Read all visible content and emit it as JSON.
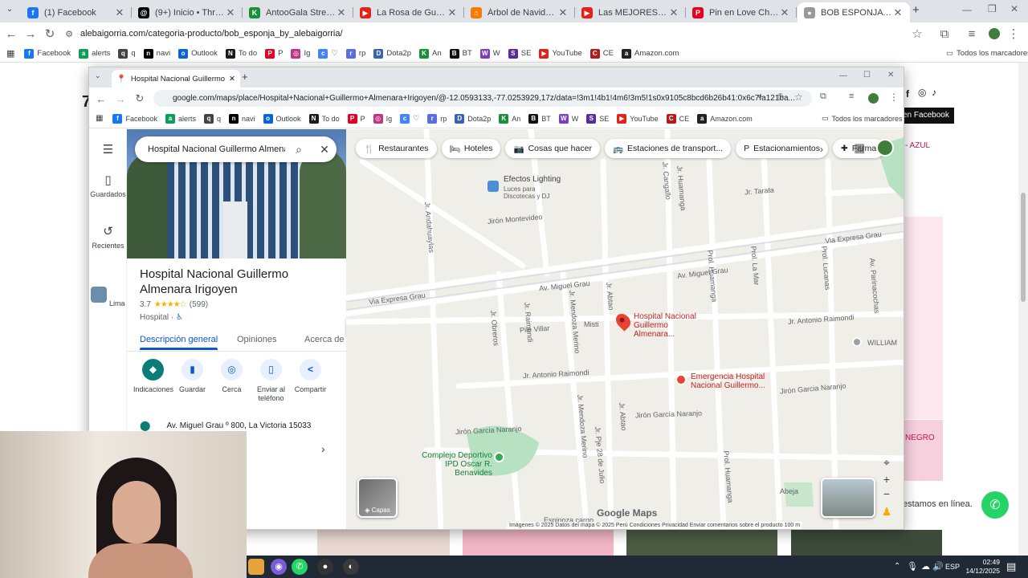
{
  "outer_tabs": [
    {
      "label": "(1) Facebook",
      "color": "#1877f2",
      "glyph": "f"
    },
    {
      "label": "(9+) Inicio • Threads",
      "color": "#000000",
      "glyph": "@"
    },
    {
      "label": "AntooGala Stream - Watch",
      "color": "#1a8f3a",
      "glyph": "K"
    },
    {
      "label": "La Rosa de Guadalupe | La",
      "color": "#e62117",
      "glyph": "▶"
    },
    {
      "label": "Árbol de Navidad Blanco",
      "color": "#f57c00",
      "glyph": "⌂"
    },
    {
      "label": "Las MEJORES OFERTAS de",
      "color": "#e62117",
      "glyph": "▶"
    },
    {
      "label": "Pin en Love Christmas",
      "color": "#e60023",
      "glyph": "P"
    },
    {
      "label": "BOB ESPONJA – Alejandra",
      "color": "#999999",
      "glyph": "●"
    }
  ],
  "outer_url": "alebaigorria.com/categoria-producto/bob_esponja_by_alebaigorria/",
  "bookmarks": [
    {
      "label": "Facebook",
      "color": "#1877f2",
      "glyph": "f"
    },
    {
      "label": "alerts",
      "color": "#0f9d58",
      "glyph": "a"
    },
    {
      "label": "q",
      "color": "#444444",
      "glyph": "q"
    },
    {
      "label": "navi",
      "color": "#000000",
      "glyph": "n"
    },
    {
      "label": "Outlook",
      "color": "#0a64d2",
      "glyph": "o"
    },
    {
      "label": "To do",
      "color": "#1b1b1b",
      "glyph": "N"
    },
    {
      "label": "P",
      "color": "#e60023",
      "glyph": "P"
    },
    {
      "label": "Ig",
      "color": "#c13584",
      "glyph": "◎"
    },
    {
      "label": "♡",
      "color": "#4285f4",
      "glyph": "c"
    },
    {
      "label": "rp",
      "color": "#5b6ee1",
      "glyph": "r"
    },
    {
      "label": "Dota2p",
      "color": "#3a63b8",
      "glyph": "D"
    },
    {
      "label": "An",
      "color": "#1a8f3a",
      "glyph": "K"
    },
    {
      "label": "BT",
      "color": "#111111",
      "glyph": "B"
    },
    {
      "label": "W",
      "color": "#7b3fbf",
      "glyph": "W"
    },
    {
      "label": "SE",
      "color": "#5a2ca0",
      "glyph": "S"
    },
    {
      "label": "YouTube",
      "color": "#e62117",
      "glyph": "▶"
    },
    {
      "label": "CE",
      "color": "#b71c1c",
      "glyph": "C"
    },
    {
      "label": "Amazon.com",
      "color": "#222222",
      "glyph": "a"
    }
  ],
  "all_bookmarks": "Todos los marcadores",
  "site": {
    "facebook_btn": "en Facebook",
    "azul": "- AZUL",
    "negro": "NEGRO",
    "whatsapp_label": "estamos en línea.",
    "signature": "7"
  },
  "maps_window": {
    "tab_label": "Hospital Nacional Guillermo Almenara",
    "url": "google.com/maps/place/Hospital+Nacional+Guillermo+Almenara+Irigoyen/@-12.0593133,-77.0253929,17z/data=!3m1!4b1!4m6!3m5!1s0x9105c8bcd6b26b41:0x6c7fa121ba...",
    "search_query": "Hospital Nacional Guillermo Almenara",
    "rail": [
      {
        "label": "Guardados",
        "glyph": "▯"
      },
      {
        "label": "Recientes",
        "glyph": "↺"
      },
      {
        "label": "Lima",
        "glyph": "▣"
      }
    ],
    "place_name": "Hospital Nacional Guillermo Almenara Irigoyen",
    "rating": "3.7",
    "stars": "★★★★☆",
    "reviews": "(599)",
    "type": "Hospital ·",
    "accessible": "♿",
    "tabs": [
      "Descripción general",
      "Opiniones",
      "Acerca de"
    ],
    "actions": [
      {
        "label": "Indicaciones",
        "glyph": "◆"
      },
      {
        "label": "Guardar",
        "glyph": "▮"
      },
      {
        "label": "Cerca",
        "glyph": "◎"
      },
      {
        "label": "Enviar al teléfono",
        "glyph": "▯"
      },
      {
        "label": "Compartir",
        "glyph": "<"
      }
    ],
    "address": "Av. Miguel Grau º 800, La Victoria 15033",
    "chips": [
      {
        "label": "Restaurantes",
        "glyph": "🍴"
      },
      {
        "label": "Hoteles",
        "glyph": "🛏"
      },
      {
        "label": "Cosas que hacer",
        "glyph": "📷"
      },
      {
        "label": "Estaciones de transport...",
        "glyph": "🚌"
      },
      {
        "label": "Estacionamientos",
        "glyph": "P"
      },
      {
        "label": "Farma",
        "glyph": "✚"
      }
    ],
    "map": {
      "streets": [
        "Jirón Montevideo",
        "Av. Miguel Grau",
        "Av. Miguel Grau",
        "Via Expresa Grau",
        "Via Expresa Grau",
        "Jr. Andahuaylas",
        "Jr. Andahuaylas",
        "Jr. Obreros",
        "Jr. Raimondi",
        "Jr. Mendoza Merino",
        "Jr. Mendoza Merino",
        "Jr. Abtao",
        "Jr. Abtao",
        "Prol. Huamanga",
        "Prol. Huamanga",
        "Jr. Huamanga",
        "Jr. Cangallo",
        "Jr. Tarata",
        "Prol. La Mar",
        "Jr. La Mar",
        "Prol. Lucanas",
        "Prol. Lucanas",
        "Av. Parinacochas",
        "Jr. Antonio Raimondi",
        "Jr. Antonio Raimondi",
        "Jirón Garcia Naranjo",
        "Jirón Garcia Naranjo",
        "Jirón Garcia Naranjo",
        "Jirón García Naranjo",
        "Jr. Garcia Naranjo",
        "Misti",
        "Pile Villar",
        "Jr. Pje 28 de Julio",
        "Abeja",
        "Espinoza cargo"
      ],
      "poi_hospital": "Hospital Nacional Guillermo Almenara...",
      "poi_emergency": "Emergencia Hospital Nacional Guillermo...",
      "poi_lighting": "Efectos Lighting",
      "poi_lighting_sub": "Luces para Discotecas y DJ",
      "poi_park": "Complejo Deportivo IPD Oscar R. Benavides",
      "poi_william": "WILLIAM",
      "layers": "Capas",
      "logo": "Google Maps",
      "attribution": "Imágenes © 2025  Datos del mapa © 2025   Perú   Condiciones   Privacidad   Enviar comentarios sobre el producto   100 m"
    }
  },
  "clock": {
    "time": "02:49",
    "date": "14/12/2025",
    "lang": "ESP"
  }
}
